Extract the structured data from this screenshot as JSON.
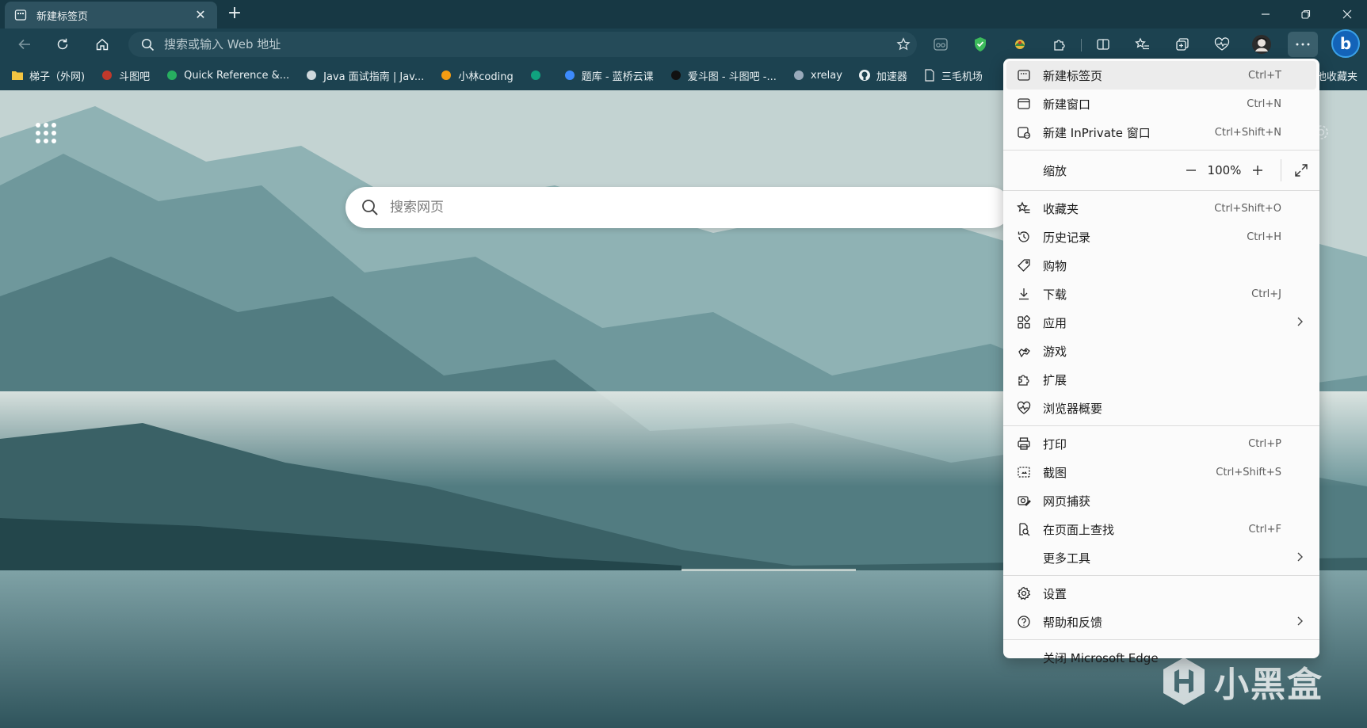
{
  "tab": {
    "title": "新建标签页"
  },
  "toolbar": {
    "address_placeholder": "搜索或输入 Web 地址"
  },
  "bookmarks": [
    {
      "label": "梯子（外网)",
      "icon": "folder-icon",
      "color": "#f4c542"
    },
    {
      "label": "斗图吧",
      "icon": "doutu-icon",
      "color": "#c0392b"
    },
    {
      "label": "Quick Reference &...",
      "icon": "quickref-icon",
      "color": "#27ae60"
    },
    {
      "label": "Java 面试指南 | Jav...",
      "icon": "java-icon",
      "color": "#cfd8dc"
    },
    {
      "label": "小林coding",
      "icon": "xiaolin-icon",
      "color": "#f39c12"
    },
    {
      "label": "",
      "icon": "chatgpt-icon",
      "color": "#10a37f"
    },
    {
      "label": "题库 - 蓝桥云课",
      "icon": "lanqiao-icon",
      "color": "#3d8bfd"
    },
    {
      "label": "爱斗图 - 斗图吧 -...",
      "icon": "aidoutu-icon",
      "color": "#111111"
    },
    {
      "label": "xrelay",
      "icon": "xrelay-icon",
      "color": "#9ab"
    },
    {
      "label": "加速器",
      "icon": "github-icon",
      "color": "#111111"
    },
    {
      "label": "三毛机场",
      "icon": "page-icon",
      "color": "#eeeeee"
    }
  ],
  "bookmarks_end": "他收藏夹",
  "newtab": {
    "search_placeholder": "搜索网页"
  },
  "watermark": {
    "text": "小黑盒"
  },
  "menu": {
    "group1": [
      {
        "label": "新建标签页",
        "shortcut": "Ctrl+T",
        "icon": "new-tab-icon"
      },
      {
        "label": "新建窗口",
        "shortcut": "Ctrl+N",
        "icon": "new-window-icon"
      },
      {
        "label": "新建 InPrivate 窗口",
        "shortcut": "Ctrl+Shift+N",
        "icon": "inprivate-icon"
      }
    ],
    "zoom": {
      "label": "缩放",
      "value": "100%"
    },
    "group2": [
      {
        "label": "收藏夹",
        "shortcut": "Ctrl+Shift+O",
        "icon": "favorites-icon"
      },
      {
        "label": "历史记录",
        "shortcut": "Ctrl+H",
        "icon": "history-icon"
      },
      {
        "label": "购物",
        "shortcut": "",
        "icon": "shopping-tag-icon"
      },
      {
        "label": "下载",
        "shortcut": "Ctrl+J",
        "icon": "download-icon"
      },
      {
        "label": "应用",
        "shortcut": "",
        "icon": "apps-icon",
        "submenu": true
      },
      {
        "label": "游戏",
        "shortcut": "",
        "icon": "games-icon"
      },
      {
        "label": "扩展",
        "shortcut": "",
        "icon": "extensions-icon"
      },
      {
        "label": "浏览器概要",
        "shortcut": "",
        "icon": "browser-essentials-icon"
      }
    ],
    "group3": [
      {
        "label": "打印",
        "shortcut": "Ctrl+P",
        "icon": "print-icon"
      },
      {
        "label": "截图",
        "shortcut": "Ctrl+Shift+S",
        "icon": "screenshot-icon"
      },
      {
        "label": "网页捕获",
        "shortcut": "",
        "icon": "web-capture-icon"
      },
      {
        "label": "在页面上查找",
        "shortcut": "Ctrl+F",
        "icon": "find-icon"
      },
      {
        "label": "更多工具",
        "shortcut": "",
        "icon": "",
        "submenu": true
      }
    ],
    "group4": [
      {
        "label": "设置",
        "shortcut": "",
        "icon": "settings-icon"
      },
      {
        "label": "帮助和反馈",
        "shortcut": "",
        "icon": "help-icon",
        "submenu": true
      }
    ],
    "group5": [
      {
        "label": "关闭 Microsoft Edge",
        "shortcut": "",
        "icon": ""
      }
    ]
  }
}
